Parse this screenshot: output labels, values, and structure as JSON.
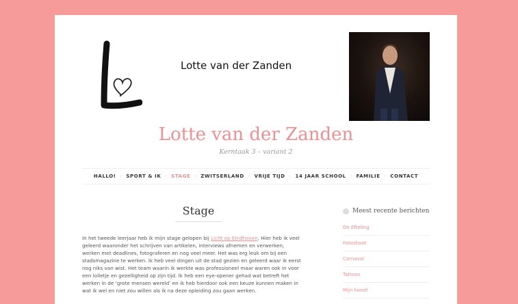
{
  "header": {
    "logo_text": "Lotte van der Zanden",
    "logo_letter": "L"
  },
  "site": {
    "title": "Lotte van der Zanden",
    "description": "Kerntaak 3 – variant 2"
  },
  "nav": {
    "items": [
      {
        "label": "HALLO!",
        "active": false
      },
      {
        "label": "SPORT & IK",
        "active": false
      },
      {
        "label": "STAGE",
        "active": true
      },
      {
        "label": "ZWITSERLAND",
        "active": false
      },
      {
        "label": "VRIJE TIJD",
        "active": false
      },
      {
        "label": "14 JAAR SCHOOL",
        "active": false
      },
      {
        "label": "FAMILIE",
        "active": false
      },
      {
        "label": "CONTACT",
        "active": false
      }
    ],
    "separator": "·"
  },
  "post": {
    "title": "Stage",
    "line1_before": "In het tweede leerjaar heb ik mijn stage gelopen bij ",
    "line1_link": "Licht op Eindhoven",
    "line1_after": ". Hier heb ik veel",
    "lines": [
      "geleerd waaronder het schrijven van artikelen, interviews afnemen en verwerken,",
      "werken met deadlines, fotograferen en nog veel meer. Het was erg leuk om bij een",
      "stadsmagazine te werken. Ik heb veel dingen uit de stad gezien en geleerd waar ik eerst",
      "nog niks van wist. Het team waarin ik werkte was professioneel maar waren ook in voor",
      "een lolletje en gezelligheid op zijn tijd. Ik heb een eye-opener gehad wat betreft het",
      "werken in de ‘grote mensen wereld’ en ik heb hierdoor ook een keuze kunnen maken in",
      "wat ik wel en niet zou willen als ik na deze opleiding zou gaan werken."
    ]
  },
  "sidebar": {
    "widget_title": "Meest recente berichten",
    "recent": [
      "De Efteling",
      "Fotoshoot",
      "Carnaval",
      "Tattoos",
      "Mijn hond!"
    ]
  },
  "colors": {
    "accent": "#ee8f92",
    "background": "#f79a9a"
  }
}
